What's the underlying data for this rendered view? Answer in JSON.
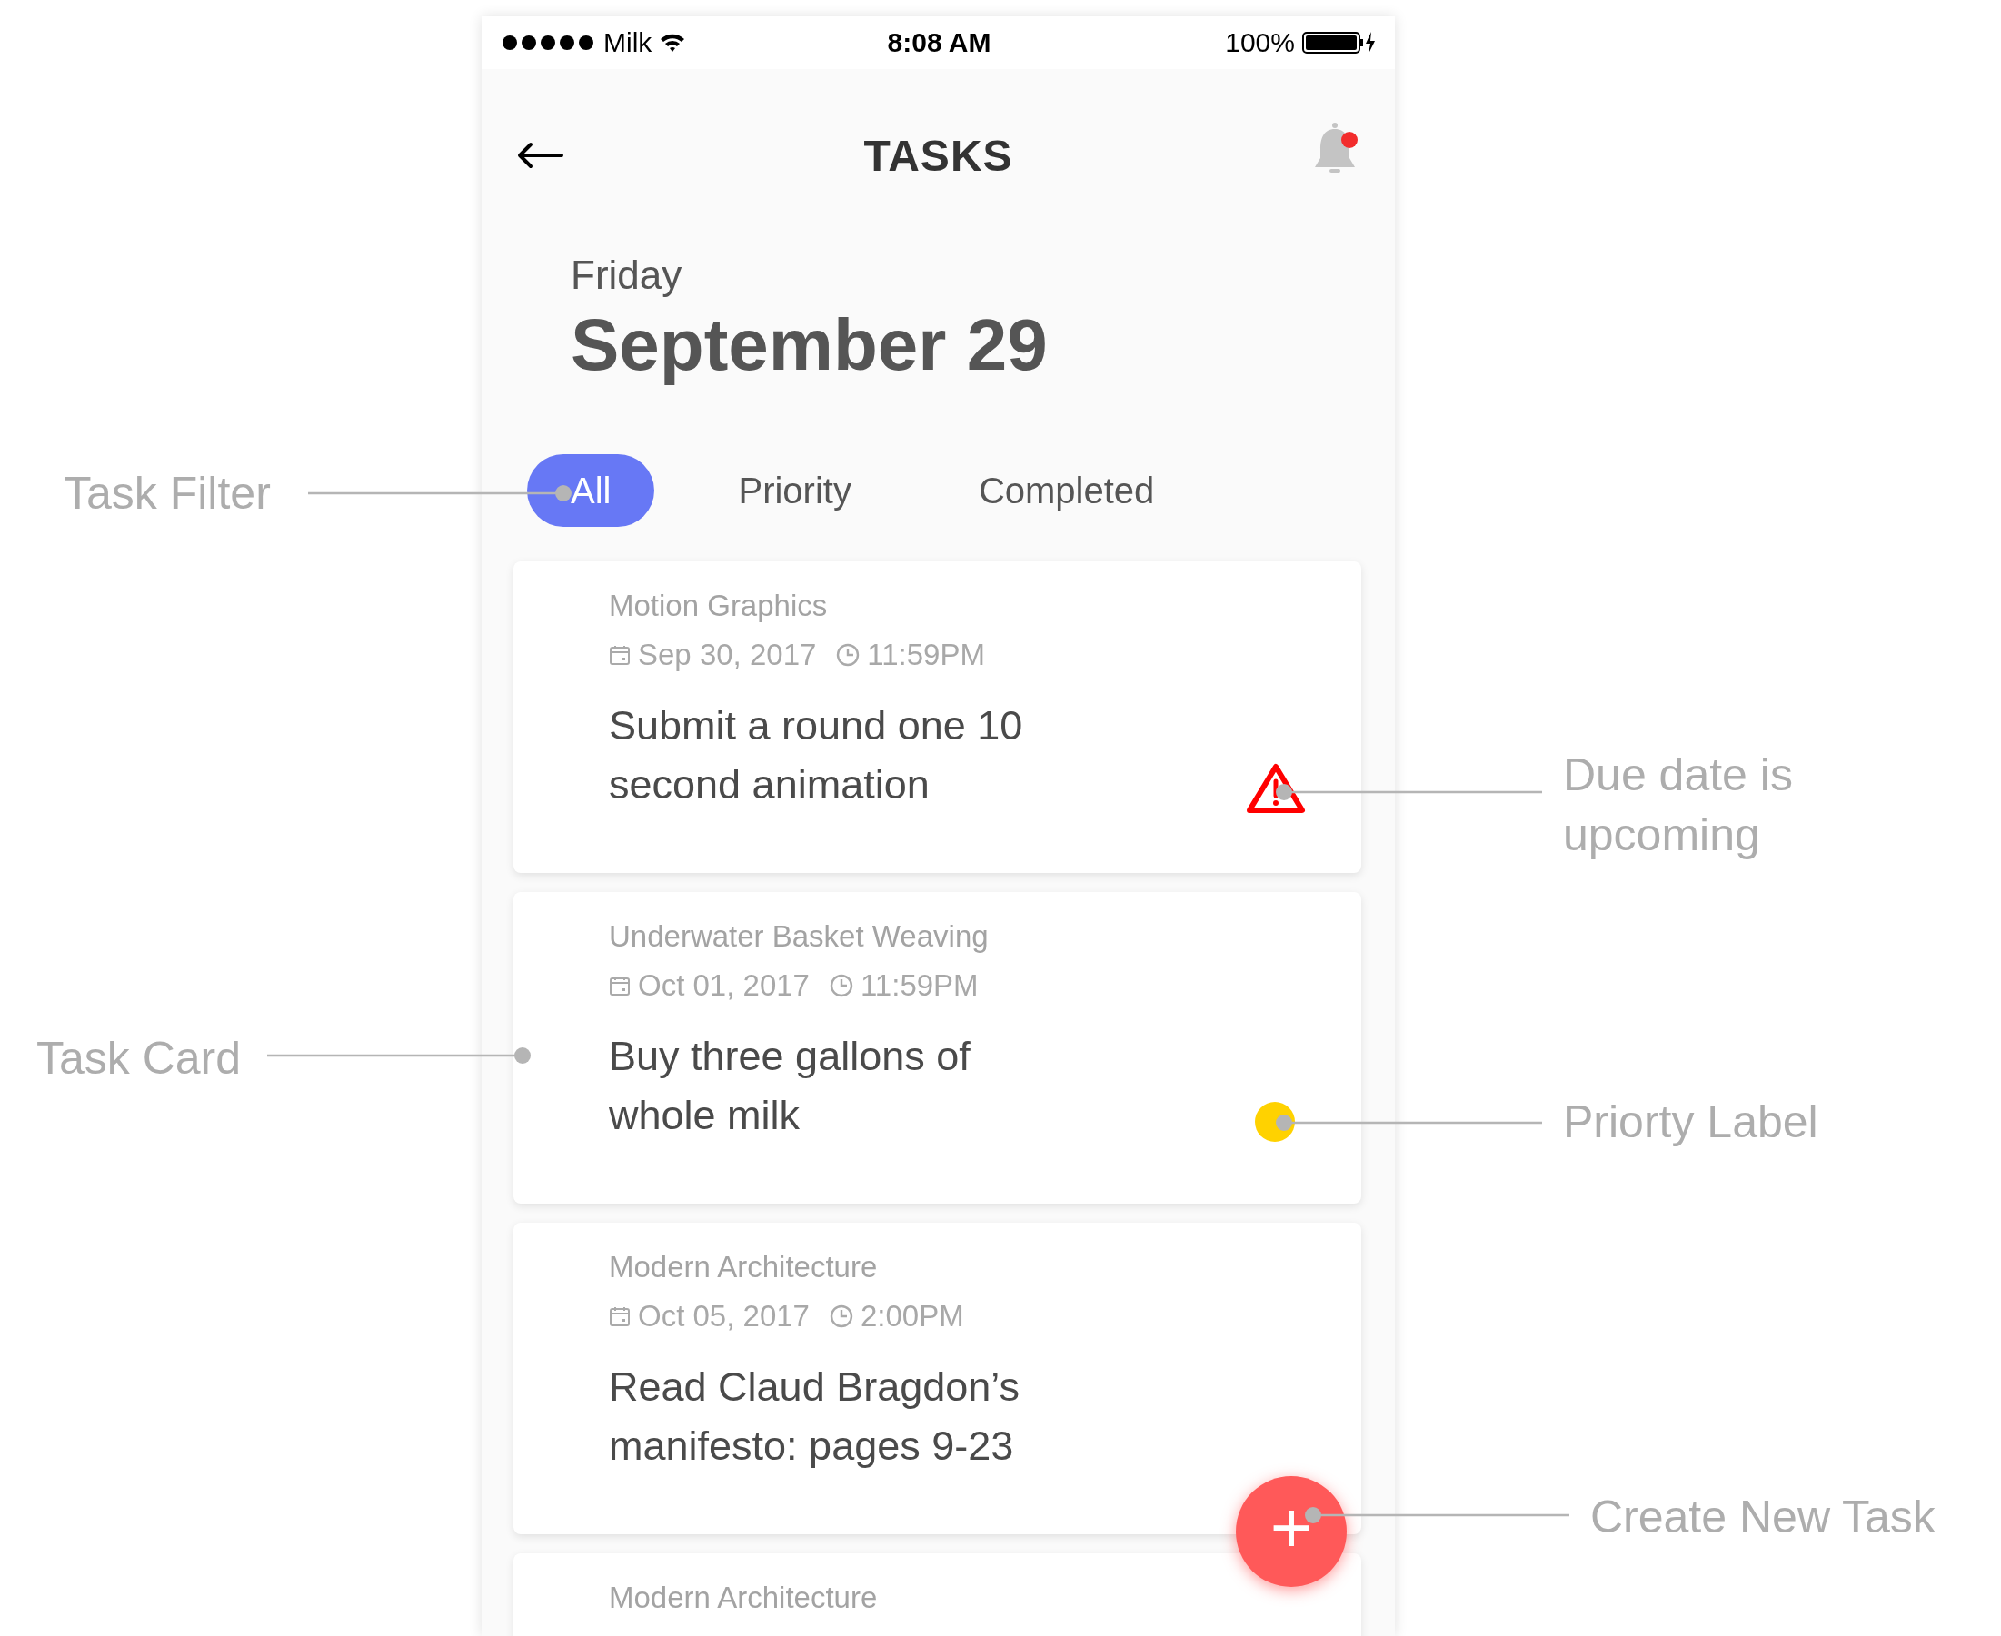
{
  "status_bar": {
    "carrier": "Milk",
    "time": "8:08 AM",
    "battery": "100%"
  },
  "header": {
    "title": "TASKS",
    "notification": true
  },
  "date": {
    "weekday": "Friday",
    "day": "September 29"
  },
  "filters": [
    {
      "label": "All",
      "selected": true
    },
    {
      "label": "Priority",
      "selected": false
    },
    {
      "label": "Completed",
      "selected": false
    }
  ],
  "tasks": [
    {
      "category": "Motion Graphics",
      "date": "Sep 30, 2017",
      "time": "11:59PM",
      "title": "Submit a round one 10\nsecond animation",
      "indicator": {
        "kind": "warning"
      }
    },
    {
      "category": "Underwater Basket Weaving",
      "date": "Oct 01, 2017",
      "time": "11:59PM",
      "title": "Buy three gallons of\nwhole milk",
      "indicator": {
        "kind": "priority",
        "color": "#ffd200"
      }
    },
    {
      "category": "Modern Architecture",
      "date": "Oct 05, 2017",
      "time": "2:00PM",
      "title": "Read Claud Bragdon’s\nmanifesto: pages 9-23",
      "indicator": {
        "kind": "none"
      }
    },
    {
      "category": "Modern Architecture"
    }
  ],
  "fab": {
    "label": "+"
  },
  "annotations": [
    {
      "label": "Task Filter"
    },
    {
      "label": "Task Card"
    },
    {
      "label": "Due date is\nupcoming"
    },
    {
      "label": "Priorty Label"
    },
    {
      "label": "Create New Task"
    }
  ]
}
